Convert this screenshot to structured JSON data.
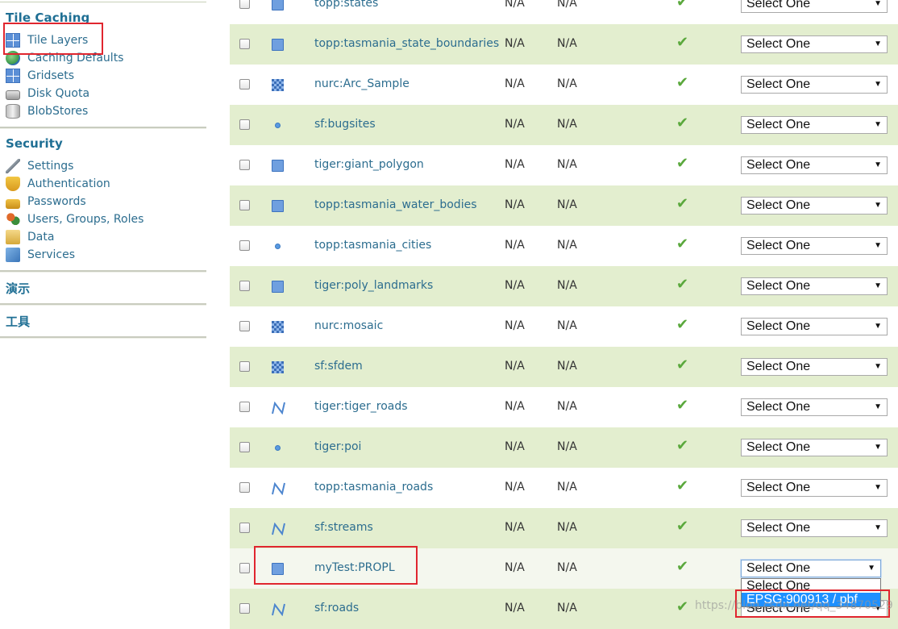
{
  "sidebar": {
    "tile_caching": {
      "heading": "Tile Caching",
      "items": [
        {
          "label": "Tile Layers",
          "icon": "grid-icon"
        },
        {
          "label": "Caching Defaults",
          "icon": "globe-icon"
        },
        {
          "label": "Gridsets",
          "icon": "grid-icon"
        },
        {
          "label": "Disk Quota",
          "icon": "disk-icon"
        },
        {
          "label": "BlobStores",
          "icon": "blobstore-icon"
        }
      ]
    },
    "security": {
      "heading": "Security",
      "items": [
        {
          "label": "Settings",
          "icon": "wrench-icon"
        },
        {
          "label": "Authentication",
          "icon": "shield-icon"
        },
        {
          "label": "Passwords",
          "icon": "lock-icon"
        },
        {
          "label": "Users, Groups, Roles",
          "icon": "users-icon"
        },
        {
          "label": "Data",
          "icon": "data-icon"
        },
        {
          "label": "Services",
          "icon": "services-icon"
        }
      ]
    },
    "demos": {
      "heading": "演示"
    },
    "tools": {
      "heading": "工具"
    }
  },
  "table": {
    "rows": [
      {
        "name": "topp:states",
        "type": "polygon",
        "c1": "N/A",
        "c2": "N/A",
        "enabled": "✔",
        "select": "Select One"
      },
      {
        "name": "topp:tasmania_state_boundaries",
        "type": "polygon",
        "c1": "N/A",
        "c2": "N/A",
        "enabled": "✔",
        "select": "Select One"
      },
      {
        "name": "nurc:Arc_Sample",
        "type": "raster",
        "c1": "N/A",
        "c2": "N/A",
        "enabled": "✔",
        "select": "Select One"
      },
      {
        "name": "sf:bugsites",
        "type": "point",
        "c1": "N/A",
        "c2": "N/A",
        "enabled": "✔",
        "select": "Select One"
      },
      {
        "name": "tiger:giant_polygon",
        "type": "polygon",
        "c1": "N/A",
        "c2": "N/A",
        "enabled": "✔",
        "select": "Select One"
      },
      {
        "name": "topp:tasmania_water_bodies",
        "type": "polygon",
        "c1": "N/A",
        "c2": "N/A",
        "enabled": "✔",
        "select": "Select One"
      },
      {
        "name": "topp:tasmania_cities",
        "type": "point",
        "c1": "N/A",
        "c2": "N/A",
        "enabled": "✔",
        "select": "Select One"
      },
      {
        "name": "tiger:poly_landmarks",
        "type": "polygon",
        "c1": "N/A",
        "c2": "N/A",
        "enabled": "✔",
        "select": "Select One"
      },
      {
        "name": "nurc:mosaic",
        "type": "raster",
        "c1": "N/A",
        "c2": "N/A",
        "enabled": "✔",
        "select": "Select One"
      },
      {
        "name": "sf:sfdem",
        "type": "raster",
        "c1": "N/A",
        "c2": "N/A",
        "enabled": "✔",
        "select": "Select One"
      },
      {
        "name": "tiger:tiger_roads",
        "type": "line",
        "c1": "N/A",
        "c2": "N/A",
        "enabled": "✔",
        "select": "Select One"
      },
      {
        "name": "tiger:poi",
        "type": "point",
        "c1": "N/A",
        "c2": "N/A",
        "enabled": "✔",
        "select": "Select One"
      },
      {
        "name": "topp:tasmania_roads",
        "type": "line",
        "c1": "N/A",
        "c2": "N/A",
        "enabled": "✔",
        "select": "Select One"
      },
      {
        "name": "sf:streams",
        "type": "line",
        "c1": "N/A",
        "c2": "N/A",
        "enabled": "✔",
        "select": "Select One"
      },
      {
        "name": "myTest:PROPL",
        "type": "polygon",
        "c1": "N/A",
        "c2": "N/A",
        "enabled": "✔",
        "select": "Select One"
      },
      {
        "name": "sf:roads",
        "type": "line",
        "c1": "N/A",
        "c2": "N/A",
        "enabled": "✔",
        "select": "Select One"
      }
    ]
  },
  "dropdown": {
    "options": [
      "Select One",
      "EPSG:900913 / pbf"
    ],
    "highlighted_color": "#1e90ff"
  },
  "watermark": "https://blog.csdn.net/qq_34870529",
  "colors": {
    "link": "#2c6d8f",
    "heading": "#1f6f94",
    "alt_row": "#e3eecf",
    "annotation": "#e0262f",
    "check": "#5aa83c"
  }
}
